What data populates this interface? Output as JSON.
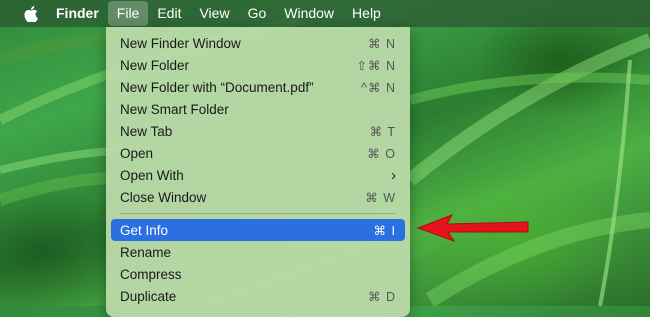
{
  "menubar": {
    "app_name": "Finder",
    "menus": [
      "File",
      "Edit",
      "View",
      "Go",
      "Window",
      "Help"
    ],
    "active_menu": "File"
  },
  "file_menu": {
    "items": [
      {
        "label": "New Finder Window",
        "shortcut": "⌘ N"
      },
      {
        "label": "New Folder",
        "shortcut": "⇧⌘ N"
      },
      {
        "label": "New Folder with “Document.pdf”",
        "shortcut": "^⌘ N"
      },
      {
        "label": "New Smart Folder",
        "shortcut": ""
      },
      {
        "label": "New Tab",
        "shortcut": "⌘ T"
      },
      {
        "label": "Open",
        "shortcut": "⌘ O"
      },
      {
        "label": "Open With",
        "shortcut": ""
      },
      {
        "label": "Close Window",
        "shortcut": "⌘ W"
      },
      {
        "label": "Get Info",
        "shortcut": "⌘ I"
      },
      {
        "label": "Rename",
        "shortcut": ""
      },
      {
        "label": "Compress",
        "shortcut": ""
      },
      {
        "label": "Duplicate",
        "shortcut": "⌘ D"
      }
    ],
    "selected_item": "Get Info"
  },
  "colors": {
    "highlight": "#2b6fe0",
    "annotation_arrow": "#e3141b"
  },
  "icons": {
    "apple": "apple-logo-icon",
    "submenu": "chevron-right-icon",
    "annotation": "red-arrow-icon"
  }
}
